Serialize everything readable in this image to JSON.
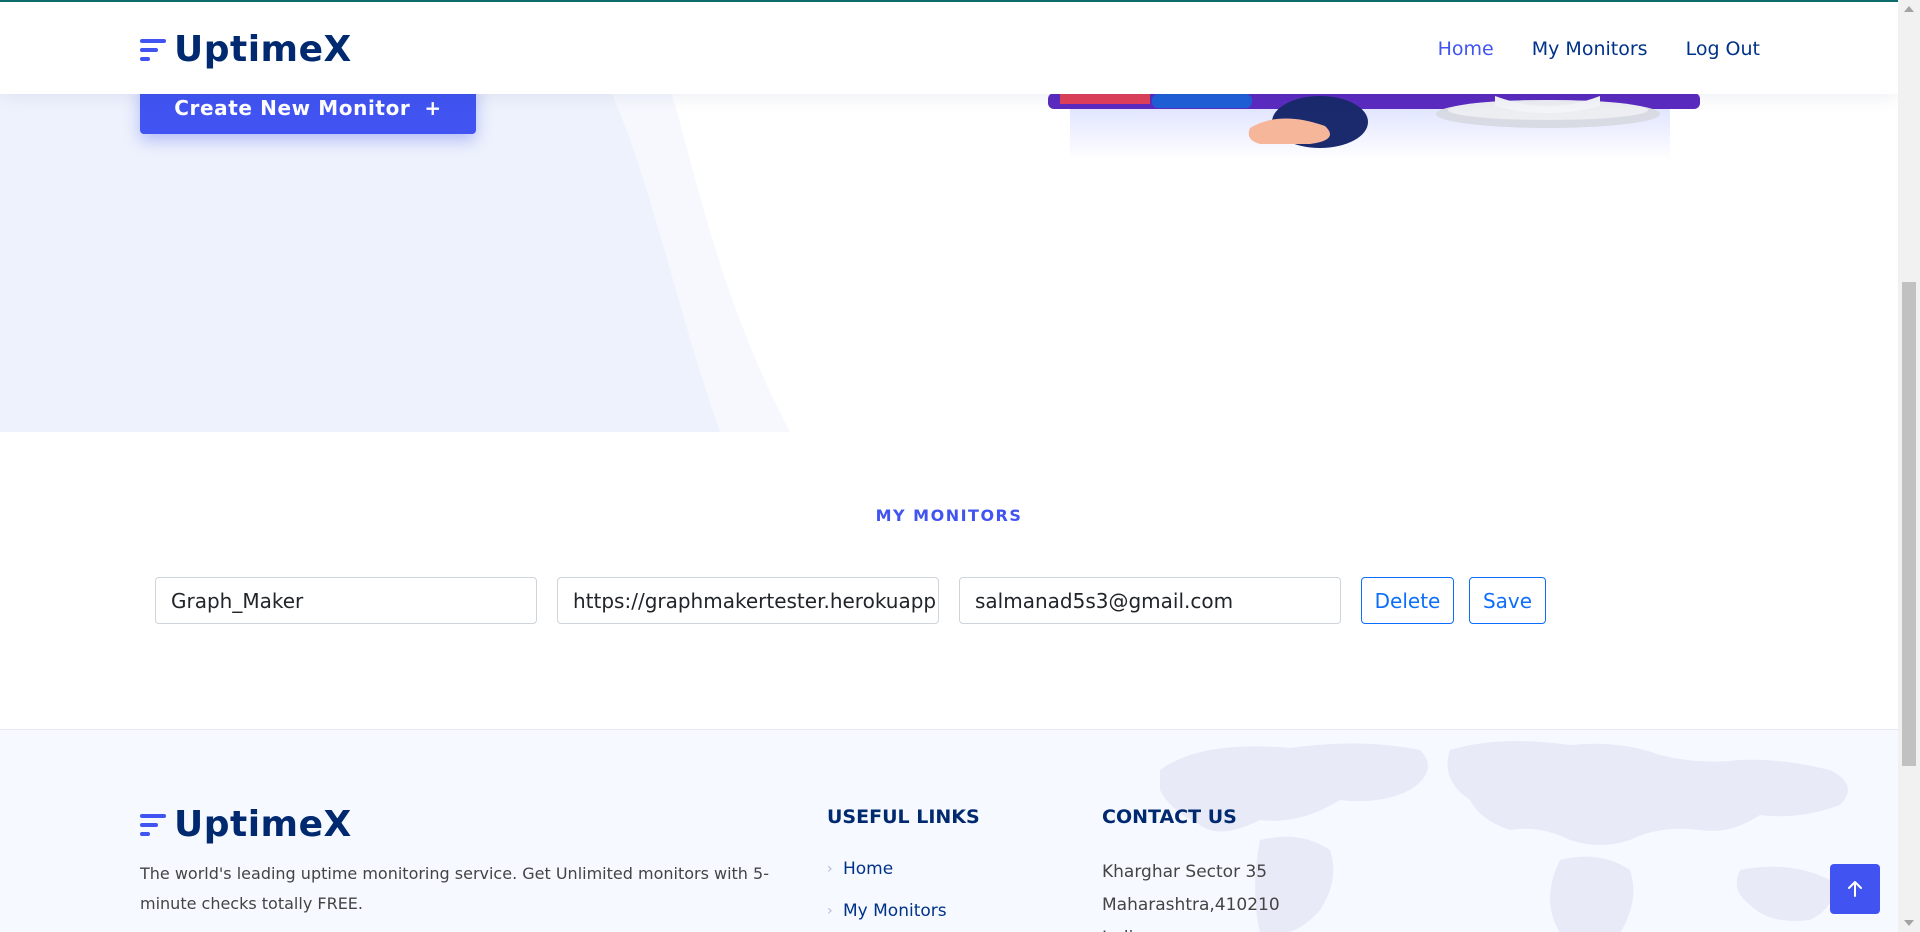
{
  "header": {
    "brand": "UptimeX",
    "nav": [
      "Home",
      "My Monitors",
      "Log Out"
    ]
  },
  "hero": {
    "create_button": "Create New Monitor",
    "create_icon": "+"
  },
  "monitors": {
    "section_title": "MY MONITORS",
    "rows": [
      {
        "name": "Graph_Maker",
        "url": "https://graphmakertester.herokuapp.",
        "email": "salmanad5s3@gmail.com",
        "delete_label": "Delete",
        "save_label": "Save"
      }
    ]
  },
  "footer": {
    "brand": "UptimeX",
    "description": "The world's leading uptime monitoring service. Get Unlimited monitors with 5-minute checks totally FREE.",
    "useful_links_title": "USEFUL LINKS",
    "useful_links": [
      "Home",
      "My Monitors"
    ],
    "contact_title": "CONTACT US",
    "contact_lines": [
      "Kharghar Sector 35",
      "Maharashtra,410210",
      "India"
    ]
  },
  "colors": {
    "accent": "#4154f1",
    "brand_dark": "#012970",
    "outline_button": "#0d6efd"
  },
  "icons": {
    "back_to_top": "arrow-up-icon",
    "link_chevron": "chevron-right-icon"
  }
}
